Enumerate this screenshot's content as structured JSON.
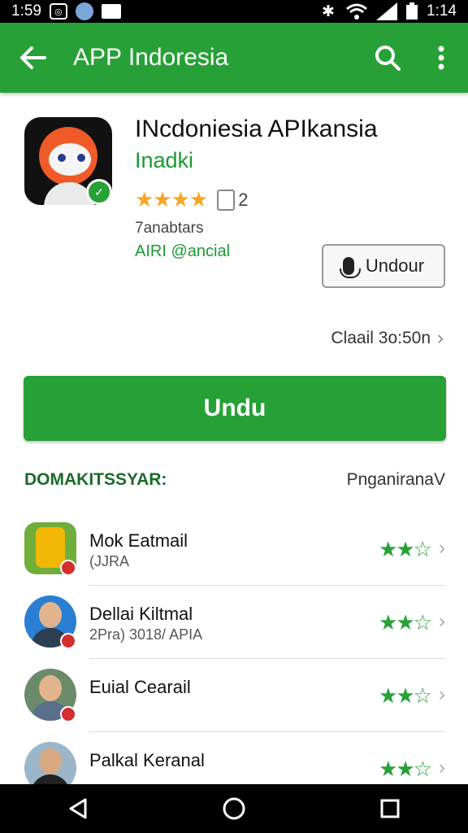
{
  "status": {
    "time_left": "1:59",
    "time_right": "1:14"
  },
  "appbar": {
    "title": "APP Indoresia"
  },
  "app": {
    "name": "INcdoniesia  APIkansia",
    "developer": "Inadki",
    "rating_stars": "★★★★",
    "reviews": "2",
    "downloads": "7anabtars",
    "tag": "AIRI @ancial",
    "secondary_button": "Undour",
    "more_info": "Claail 3o:50n"
  },
  "primary_button": "Undu",
  "section": {
    "title": "DOMAKITSSYAR:",
    "action": "PnganiranaV"
  },
  "related": [
    {
      "name": "Mok Eatmail",
      "sub": "(JJRA",
      "stars": "★★☆"
    },
    {
      "name": "Dellai Kiltmal",
      "sub": "2Pra) 3018/ APIA",
      "stars": "★★☆"
    },
    {
      "name": "Euial Cearail",
      "sub": "",
      "stars": "★★☆"
    },
    {
      "name": "Palkal Keranal",
      "sub": "",
      "stars": "★★☆"
    }
  ],
  "colors": {
    "accent": "#27a137",
    "star_gold": "#f5a623"
  }
}
